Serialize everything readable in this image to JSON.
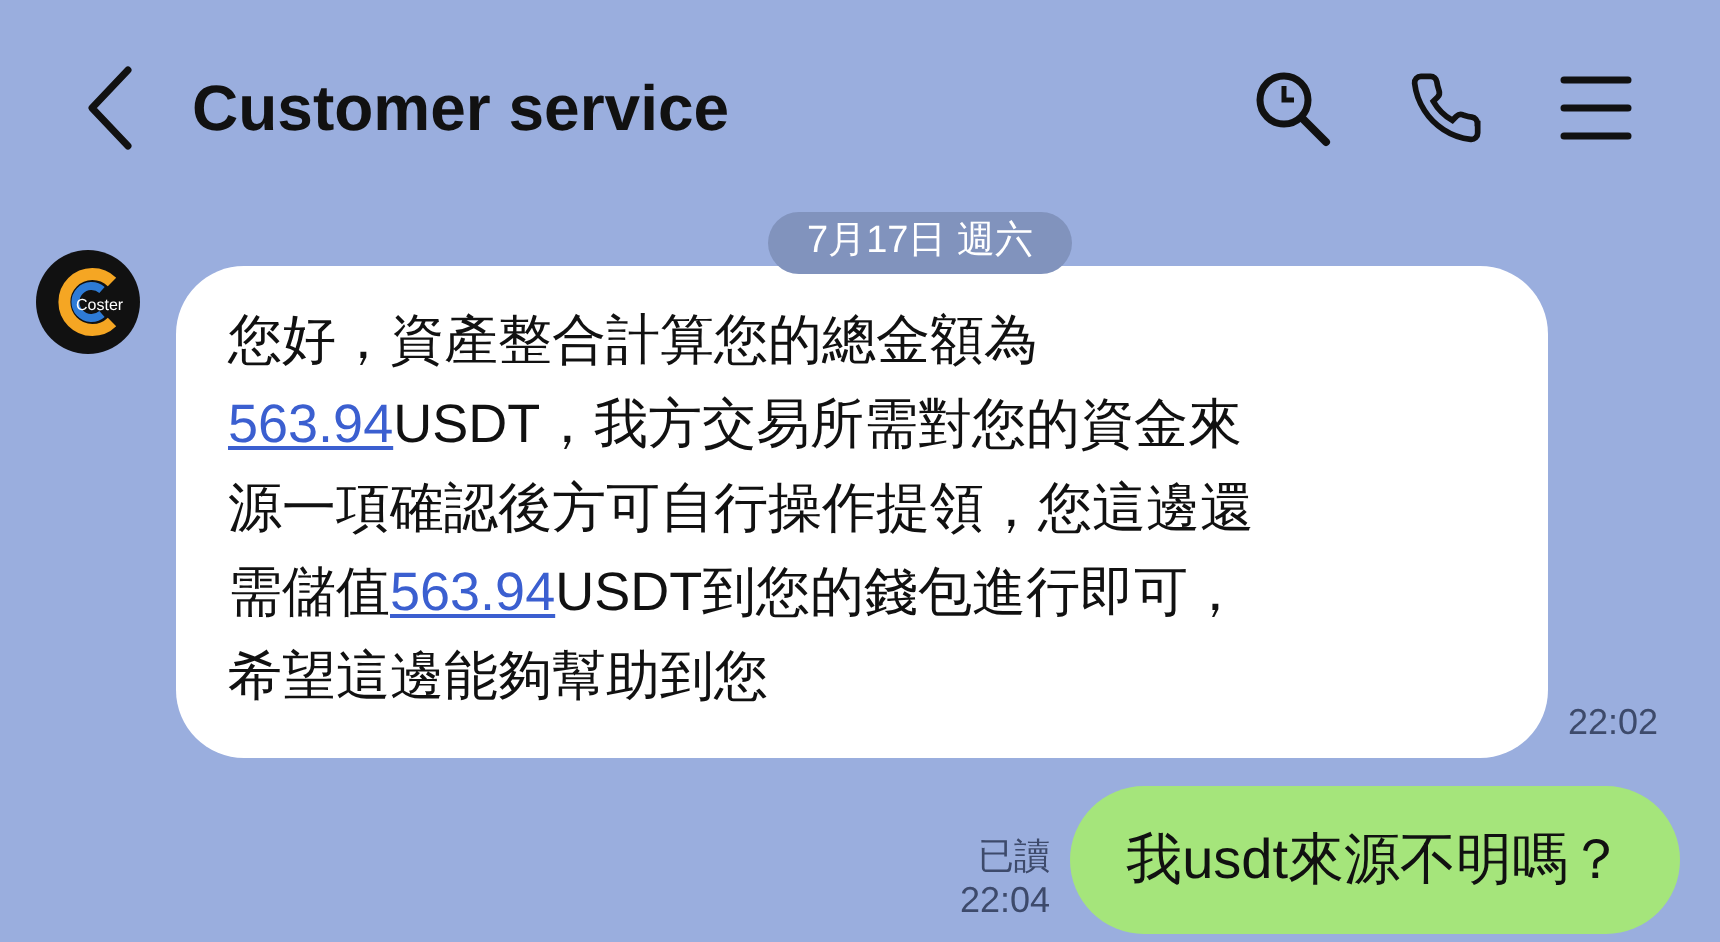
{
  "header": {
    "title": "Customer service"
  },
  "date_label": "7月17日 週六",
  "incoming": {
    "avatar_text": "Coster",
    "time": "22:02",
    "lines": [
      [
        {
          "kind": "text",
          "text": "您好，資產整合計算您的總金額為"
        }
      ],
      [
        {
          "kind": "link",
          "text": "563.94"
        },
        {
          "kind": "text",
          "text": "USDT，我方交易所需對您的資金來"
        }
      ],
      [
        {
          "kind": "text",
          "text": "源一項確認後方可自行操作提領，您這邊還"
        }
      ],
      [
        {
          "kind": "text",
          "text": "需儲值"
        },
        {
          "kind": "link",
          "text": "563.94"
        },
        {
          "kind": "text",
          "text": "USDT到您的錢包進行即可，"
        }
      ],
      [
        {
          "kind": "text",
          "text": "希望這邊能夠幫助到您"
        }
      ]
    ]
  },
  "outgoing": {
    "read_label": "已讀",
    "time": "22:04",
    "text": "我usdt來源不明嗎？"
  }
}
